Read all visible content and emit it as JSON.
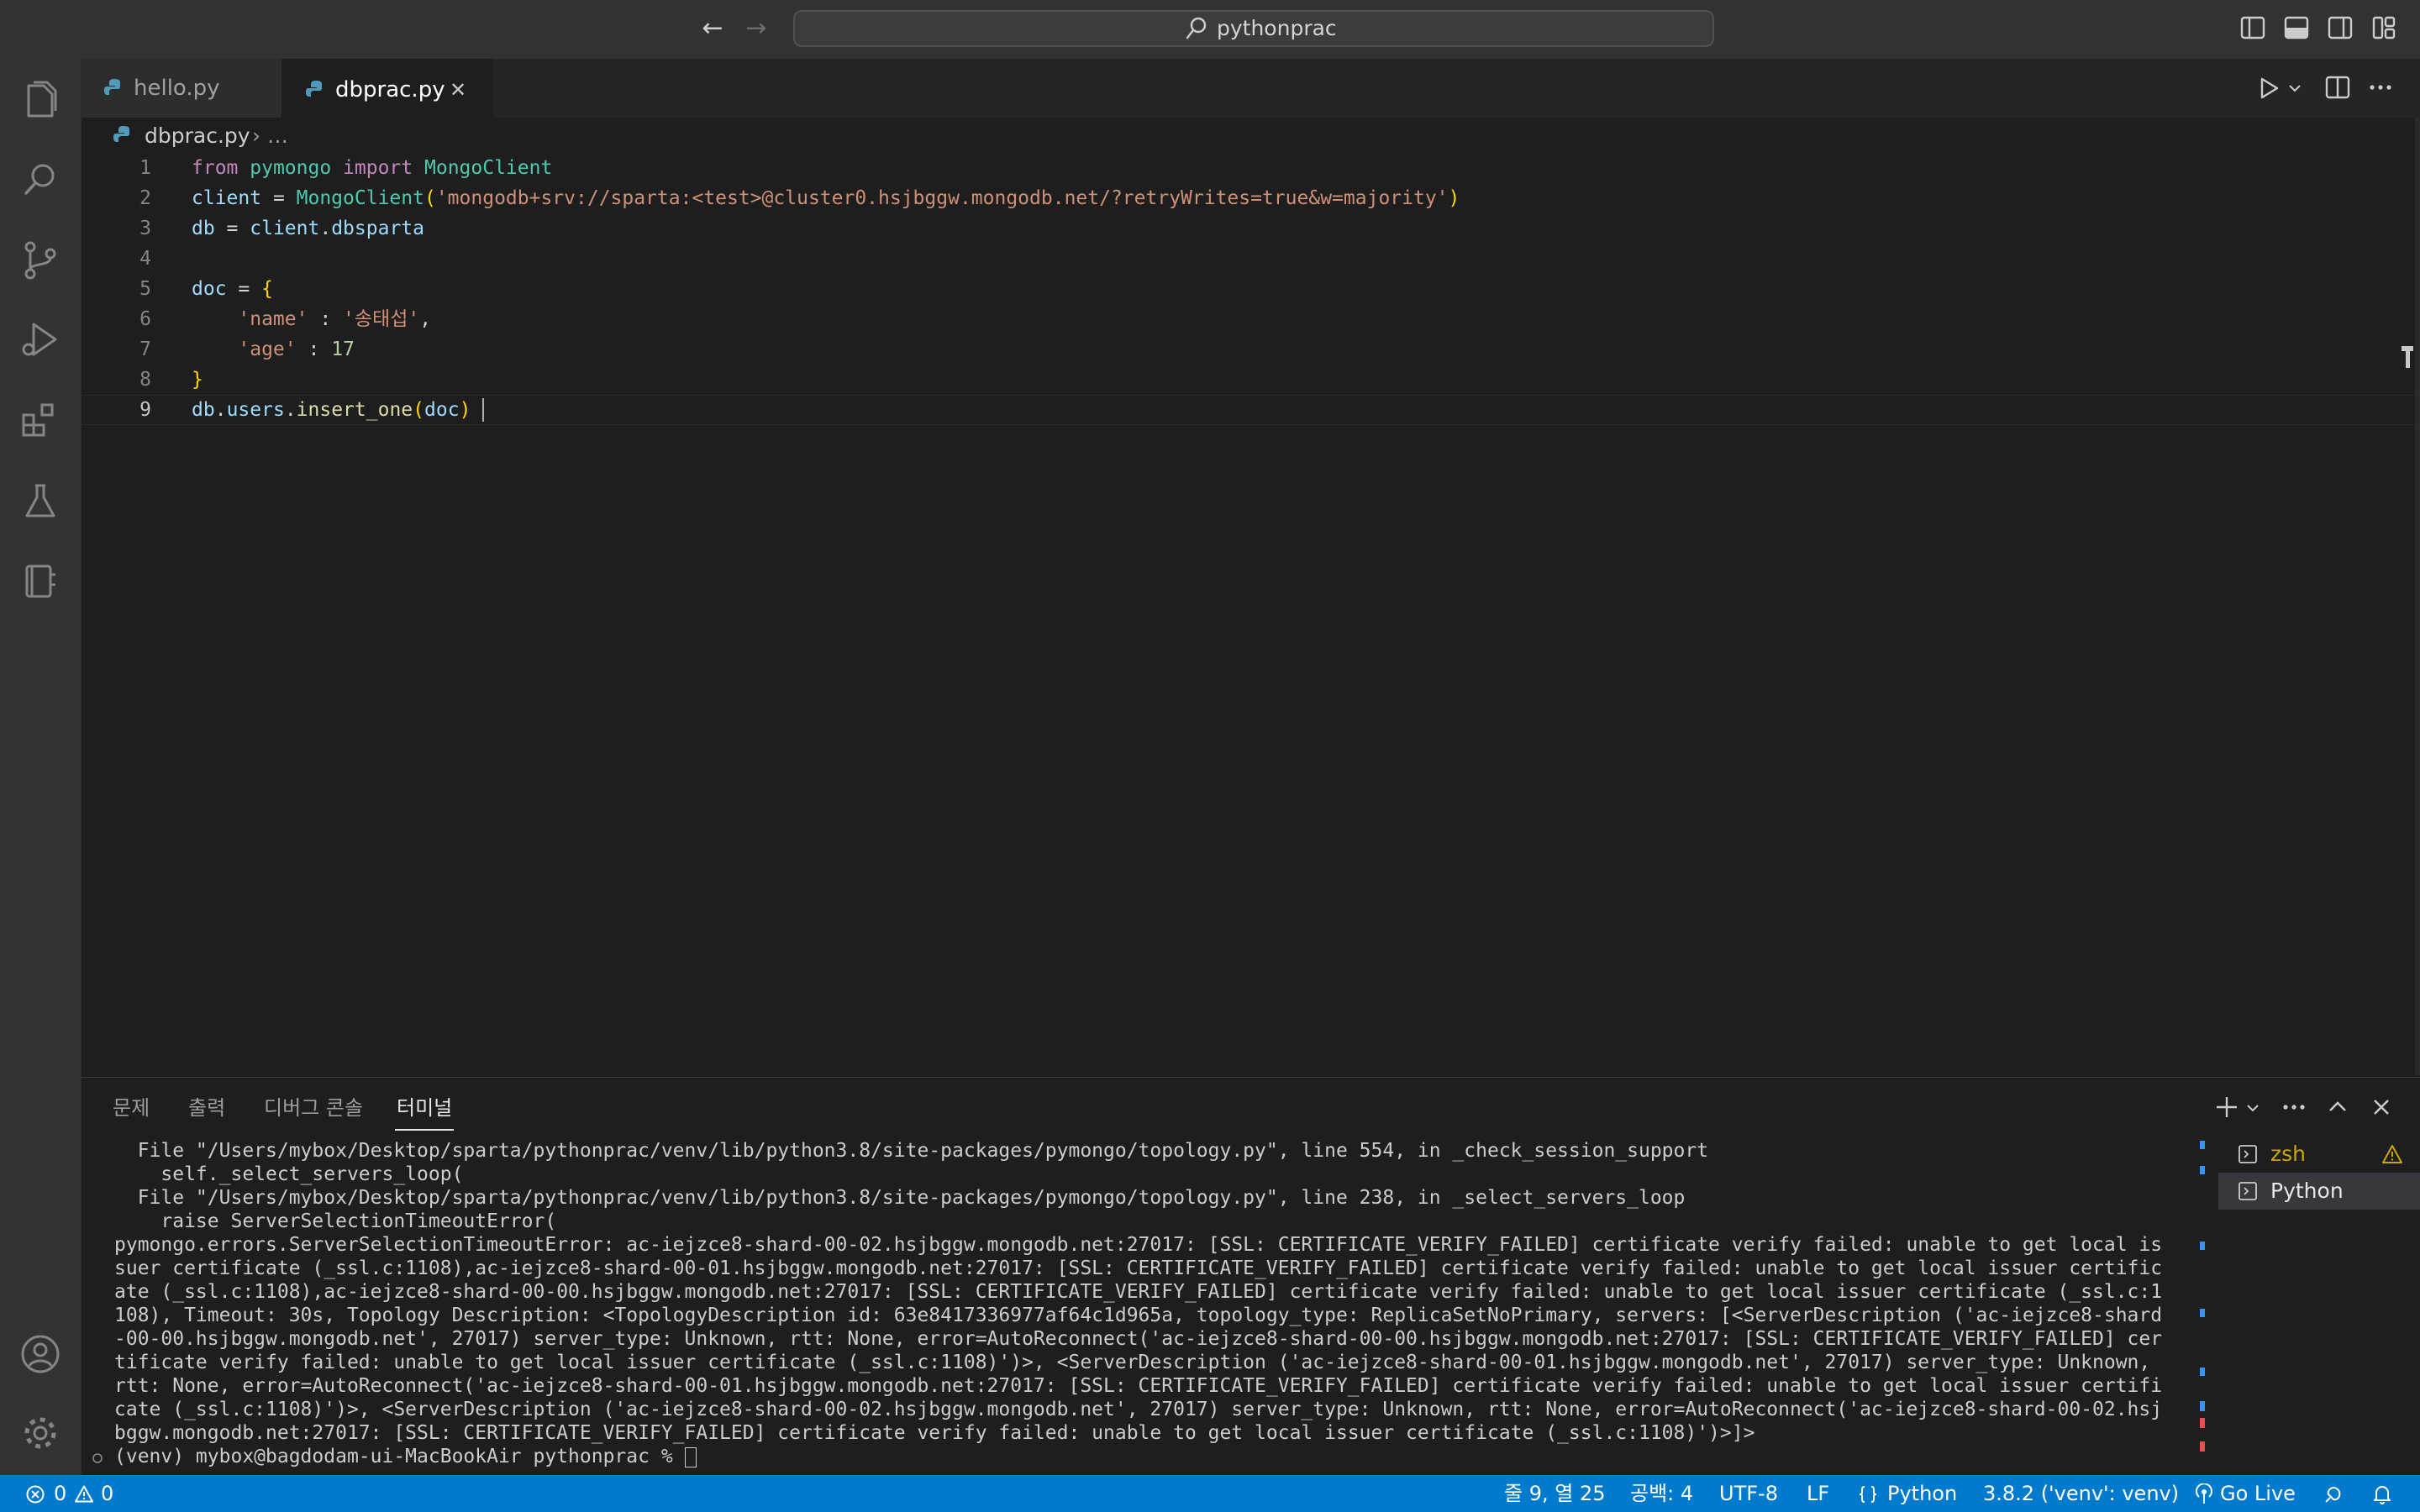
{
  "titlebar": {
    "search_text": "pythonprac"
  },
  "tabs": [
    {
      "label": "hello.py",
      "active": false
    },
    {
      "label": "dbprac.py",
      "active": true,
      "close_glyph": "✕"
    }
  ],
  "breadcrumb": {
    "file": "dbprac.py",
    "rest": "› …"
  },
  "editor": {
    "line_numbers": [
      "1",
      "2",
      "3",
      "4",
      "5",
      "6",
      "7",
      "8",
      "9"
    ],
    "lines": [
      [
        [
          "kw",
          "from"
        ],
        [
          "",
          " "
        ],
        [
          "mod",
          "pymongo"
        ],
        [
          "",
          " "
        ],
        [
          "kw",
          "import"
        ],
        [
          "",
          " "
        ],
        [
          "cls",
          "MongoClient"
        ]
      ],
      [
        [
          "var",
          "client"
        ],
        [
          "",
          " = "
        ],
        [
          "cls",
          "MongoClient"
        ],
        [
          "br1",
          "("
        ],
        [
          "str",
          "'mongodb+srv://sparta:<test>@cluster0.hsjbggw.mongodb.net/?retryWrites=true&w=majority'"
        ],
        [
          "br1",
          ")"
        ]
      ],
      [
        [
          "var",
          "db"
        ],
        [
          "",
          " = "
        ],
        [
          "var",
          "client"
        ],
        [
          "",
          "."
        ],
        [
          "var",
          "dbsparta"
        ]
      ],
      [],
      [
        [
          "var",
          "doc"
        ],
        [
          "",
          " = "
        ],
        [
          "br1",
          "{"
        ]
      ],
      [
        [
          "",
          "    "
        ],
        [
          "str",
          "'name'"
        ],
        [
          "",
          " : "
        ],
        [
          "str",
          "'송태섭'"
        ],
        [
          "",
          ","
        ]
      ],
      [
        [
          "",
          "    "
        ],
        [
          "str",
          "'age'"
        ],
        [
          "",
          " : "
        ],
        [
          "num",
          "17"
        ]
      ],
      [
        [
          "br1",
          "}"
        ]
      ],
      [
        [
          "var",
          "db"
        ],
        [
          "",
          "."
        ],
        [
          "var",
          "users"
        ],
        [
          "",
          "."
        ],
        [
          "fn",
          "insert_one"
        ],
        [
          "br1",
          "("
        ],
        [
          "var",
          "doc"
        ],
        [
          "br1",
          ")"
        ]
      ]
    ]
  },
  "panel": {
    "tabs": [
      "문제",
      "출력",
      "디버그 콘솔",
      "터미널"
    ],
    "active_tab": "터미널",
    "terminal_lines": [
      "  File \"/Users/mybox/Desktop/sparta/pythonprac/venv/lib/python3.8/site-packages/pymongo/topology.py\", line 554, in _check_session_support",
      "    self._select_servers_loop(",
      "  File \"/Users/mybox/Desktop/sparta/pythonprac/venv/lib/python3.8/site-packages/pymongo/topology.py\", line 238, in _select_servers_loop",
      "    raise ServerSelectionTimeoutError(",
      "pymongo.errors.ServerSelectionTimeoutError: ac-iejzce8-shard-00-02.hsjbggw.mongodb.net:27017: [SSL: CERTIFICATE_VERIFY_FAILED] certificate verify failed: unable to get local is",
      "suer certificate (_ssl.c:1108),ac-iejzce8-shard-00-01.hsjbggw.mongodb.net:27017: [SSL: CERTIFICATE_VERIFY_FAILED] certificate verify failed: unable to get local issuer certific",
      "ate (_ssl.c:1108),ac-iejzce8-shard-00-00.hsjbggw.mongodb.net:27017: [SSL: CERTIFICATE_VERIFY_FAILED] certificate verify failed: unable to get local issuer certificate (_ssl.c:1",
      "108), Timeout: 30s, Topology Description: <TopologyDescription id: 63e8417336977af64c1d965a, topology_type: ReplicaSetNoPrimary, servers: [<ServerDescription ('ac-iejzce8-shard",
      "-00-00.hsjbggw.mongodb.net', 27017) server_type: Unknown, rtt: None, error=AutoReconnect('ac-iejzce8-shard-00-00.hsjbggw.mongodb.net:27017: [SSL: CERTIFICATE_VERIFY_FAILED] cer",
      "tificate verify failed: unable to get local issuer certificate (_ssl.c:1108)')>, <ServerDescription ('ac-iejzce8-shard-00-01.hsjbggw.mongodb.net', 27017) server_type: Unknown,",
      "rtt: None, error=AutoReconnect('ac-iejzce8-shard-00-01.hsjbggw.mongodb.net:27017: [SSL: CERTIFICATE_VERIFY_FAILED] certificate verify failed: unable to get local issuer certifi",
      "cate (_ssl.c:1108)')>, <ServerDescription ('ac-iejzce8-shard-00-02.hsjbggw.mongodb.net', 27017) server_type: Unknown, rtt: None, error=AutoReconnect('ac-iejzce8-shard-00-02.hsj",
      "bggw.mongodb.net:27017: [SSL: CERTIFICATE_VERIFY_FAILED] certificate verify failed: unable to get local issuer certificate (_ssl.c:1108)')>]>"
    ],
    "prompt": "(venv) mybox@bagdodam-ui-MacBookAir pythonprac % ",
    "terminals": [
      {
        "label": "zsh",
        "warning": true
      },
      {
        "label": "Python",
        "selected": true
      }
    ]
  },
  "statusbar": {
    "errors": "0",
    "warnings": "0",
    "position": "줄 9, 열 25",
    "spaces": "공백: 4",
    "encoding": "UTF-8",
    "eol": "LF",
    "language": "Python",
    "interpreter": "3.8.2 ('venv': venv)",
    "golive": "Go Live"
  },
  "colors": {
    "statusbar": "#007acc",
    "editor_bg": "#1e1e1e",
    "keyword": "#c586c0",
    "string": "#ce9178",
    "warning": "#cca700"
  }
}
